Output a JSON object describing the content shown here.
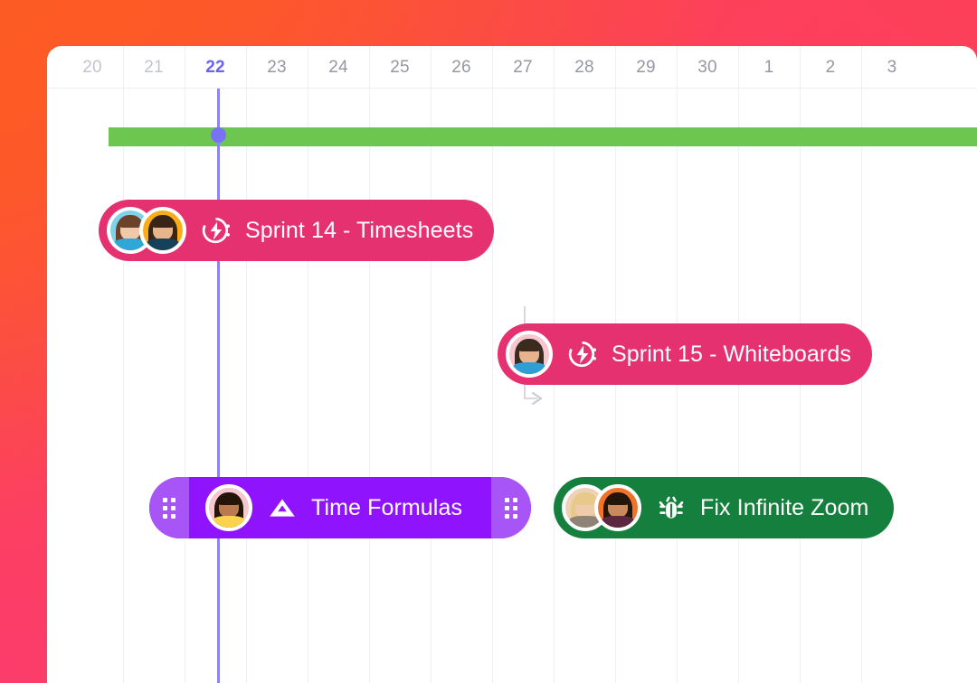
{
  "theme": {
    "bg_gradient_top_left": "#FD5A25",
    "bg_gradient_top_right": "#FD4058",
    "bg_gradient_bottom_left": "#FC3C6A",
    "bg_gradient_bottom_right": "#FA29A1",
    "panel_bg": "#FFFFFF",
    "grid_line": "#F0F0F3",
    "header_border": "#EDEDF1",
    "today_accent": "#6C63F5",
    "today_line": "#8B84F7",
    "progress_green": "#6DC64F",
    "sprint_pink": "#E5316F",
    "task_purple": "#9013FE",
    "task_purple_handle": "#A855F7",
    "bug_green": "#15803D",
    "day_label": "#9597A3",
    "day_label_dim": "#C3C5CE",
    "connector": "#D8D8DE"
  },
  "timeline": {
    "days": [
      {
        "label": "20",
        "state": "dim"
      },
      {
        "label": "21",
        "state": "dim"
      },
      {
        "label": "22",
        "state": "today"
      },
      {
        "label": "23",
        "state": "normal"
      },
      {
        "label": "24",
        "state": "normal"
      },
      {
        "label": "25",
        "state": "normal"
      },
      {
        "label": "26",
        "state": "normal"
      },
      {
        "label": "27",
        "state": "normal"
      },
      {
        "label": "28",
        "state": "normal"
      },
      {
        "label": "29",
        "state": "normal"
      },
      {
        "label": "30",
        "state": "normal"
      },
      {
        "label": "1",
        "state": "normal"
      },
      {
        "label": "2",
        "state": "normal"
      },
      {
        "label": "3",
        "state": "normal"
      }
    ],
    "today_label": "22"
  },
  "progress_bar": {
    "name": "project-progress-band",
    "color": "#6DC64F"
  },
  "tasks": [
    {
      "id": "sprint-14",
      "label": "Sprint 14 - Timesheets",
      "color": "#E5316F",
      "icon": "sprint-icon",
      "avatars": [
        {
          "name": "avatar-woman-blue",
          "bg": "#7FD2E8",
          "hair": "#6B4328",
          "skin": "#F2C9A8",
          "shirt": "#2FA8D8"
        },
        {
          "name": "avatar-woman-orange",
          "bg": "#F9AE17",
          "hair": "#3A2418",
          "skin": "#E8B48C",
          "shirt": "#17405A"
        }
      ],
      "draggable": false
    },
    {
      "id": "sprint-15",
      "label": "Sprint 15 - Whiteboards",
      "color": "#E5316F",
      "icon": "sprint-icon",
      "avatars": [
        {
          "name": "avatar-man-pink",
          "bg": "#F6C7CE",
          "hair": "#3B2A1E",
          "skin": "#E9B28E",
          "shirt": "#2E9FD4"
        }
      ],
      "draggable": false
    },
    {
      "id": "time-formulas",
      "label": "Time Formulas",
      "color": "#9013FE",
      "icon": "milestone-icon",
      "avatars": [
        {
          "name": "avatar-woman-curly",
          "bg": "#F6C7CE",
          "hair": "#241509",
          "skin": "#B97A4E",
          "shirt": "#FBD34D"
        }
      ],
      "draggable": true,
      "handle_icon": "drag-handle-icon"
    },
    {
      "id": "fix-infinite-zoom",
      "label": "Fix Infinite Zoom",
      "color": "#15803D",
      "icon": "bug-icon",
      "avatars": [
        {
          "name": "avatar-woman-blonde",
          "bg": "#EFD2B6",
          "hair": "#E7C98A",
          "skin": "#F0CBAB",
          "shirt": "#8F8276"
        },
        {
          "name": "avatar-man-orange",
          "bg": "#F2722A",
          "hair": "#241509",
          "skin": "#C98A5E",
          "shirt": "#5C2740"
        }
      ],
      "draggable": false
    }
  ],
  "dependency": {
    "name": "dependency-connector",
    "from_task": "sprint-14",
    "to_task": "sprint-15",
    "arrow": "arrow-right-icon"
  }
}
